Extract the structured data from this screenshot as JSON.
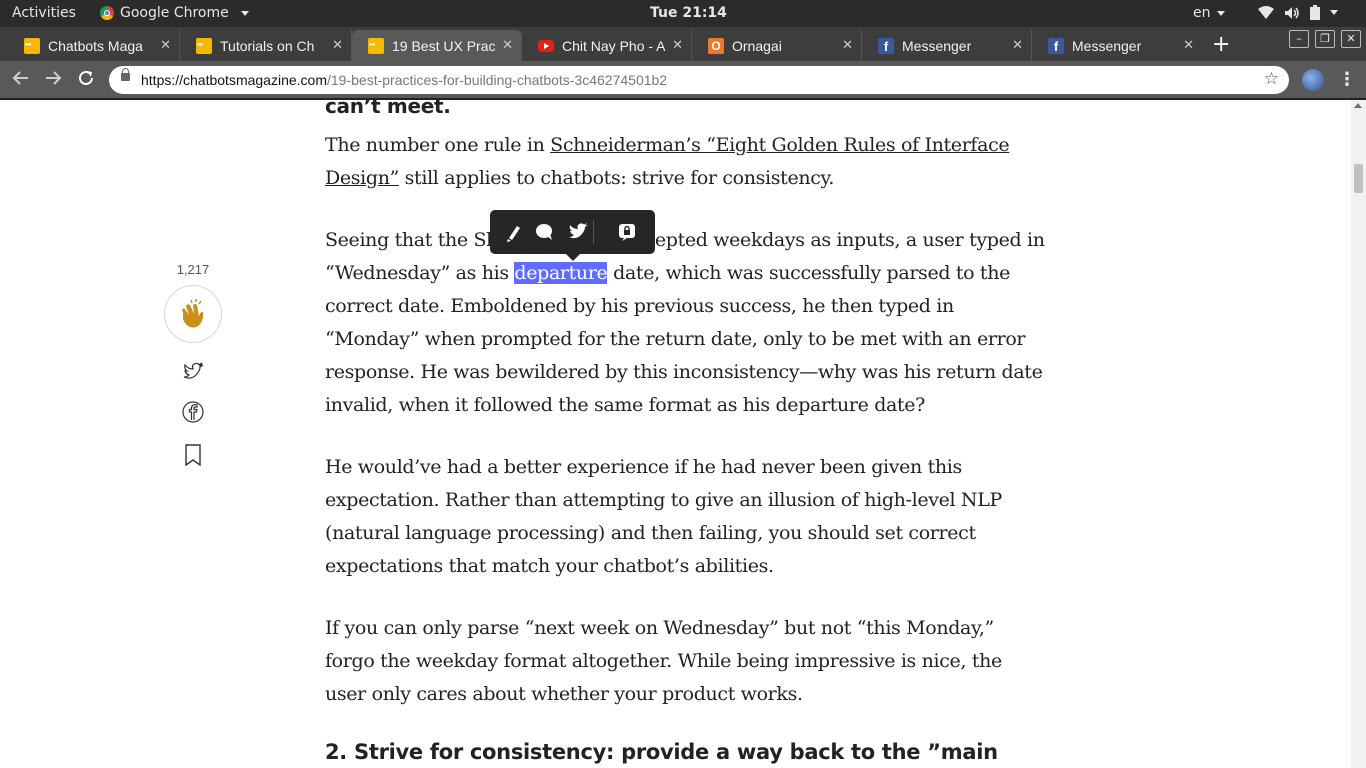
{
  "system_bar": {
    "activities": "Activities",
    "app_name": "Google Chrome",
    "clock": "Tue 21:14",
    "language": "en"
  },
  "tabs": [
    {
      "title": "Chatbots Maga",
      "favicon": "chatbots-magazine-icon",
      "active": false
    },
    {
      "title": "Tutorials on Ch",
      "favicon": "chatbots-magazine-icon",
      "active": false
    },
    {
      "title": "19 Best UX Prac",
      "favicon": "chatbots-magazine-icon",
      "active": true
    },
    {
      "title": "Chit Nay Pho - A",
      "favicon": "youtube-icon",
      "active": false
    },
    {
      "title": "Ornagai",
      "favicon": "ornagai-icon",
      "active": false
    },
    {
      "title": "Messenger",
      "favicon": "facebook-icon",
      "active": false
    },
    {
      "title": "Messenger",
      "favicon": "facebook-icon",
      "active": false
    }
  ],
  "address_bar": {
    "url_host": "https://chatbotsmagazine.com",
    "url_path": "/19-best-practices-for-building-chatbots-3c46274501b2"
  },
  "article": {
    "heading_top": "can’t meet.",
    "para1": {
      "before": "The number one rule in ",
      "link": "Schneiderman’s “Eight Golden Rules of Interface Design”",
      "after": " still applies to chatbots: strive for consistency."
    },
    "para2": {
      "before": "Seeing that the Skyscanner bot accepted weekdays as inputs, a user typed in “Wednesday” as his ",
      "highlight": "departure",
      "after": " date, which was successfully parsed to the correct date. Emboldened by his previous success, he then typed in “Monday” when prompted for the return date, only to be met with an error response. He was bewildered by this inconsistency—why was his return date invalid, when it followed the same format as his departure date?"
    },
    "para3": "He would’ve had a better experience if he had never been given this expectation. Rather than attempting to give an illusion of high-level NLP (natural language processing) and then failing, you should set correct expectations that match your chatbot’s abilities.",
    "para4": "If you can only parse “next week on Wednesday” but not “this Monday,” forgo the weekday format altogether. While being impressive is nice, the user only cares about whether your product works.",
    "heading_bottom": "2. Strive for consistency: provide a way back to the ”main"
  },
  "share_rail": {
    "clap_count": "1,217"
  },
  "colors": {
    "highlight": "#5f6cff",
    "menu_bg": "#262626",
    "clap_gold": "#c8901a"
  }
}
